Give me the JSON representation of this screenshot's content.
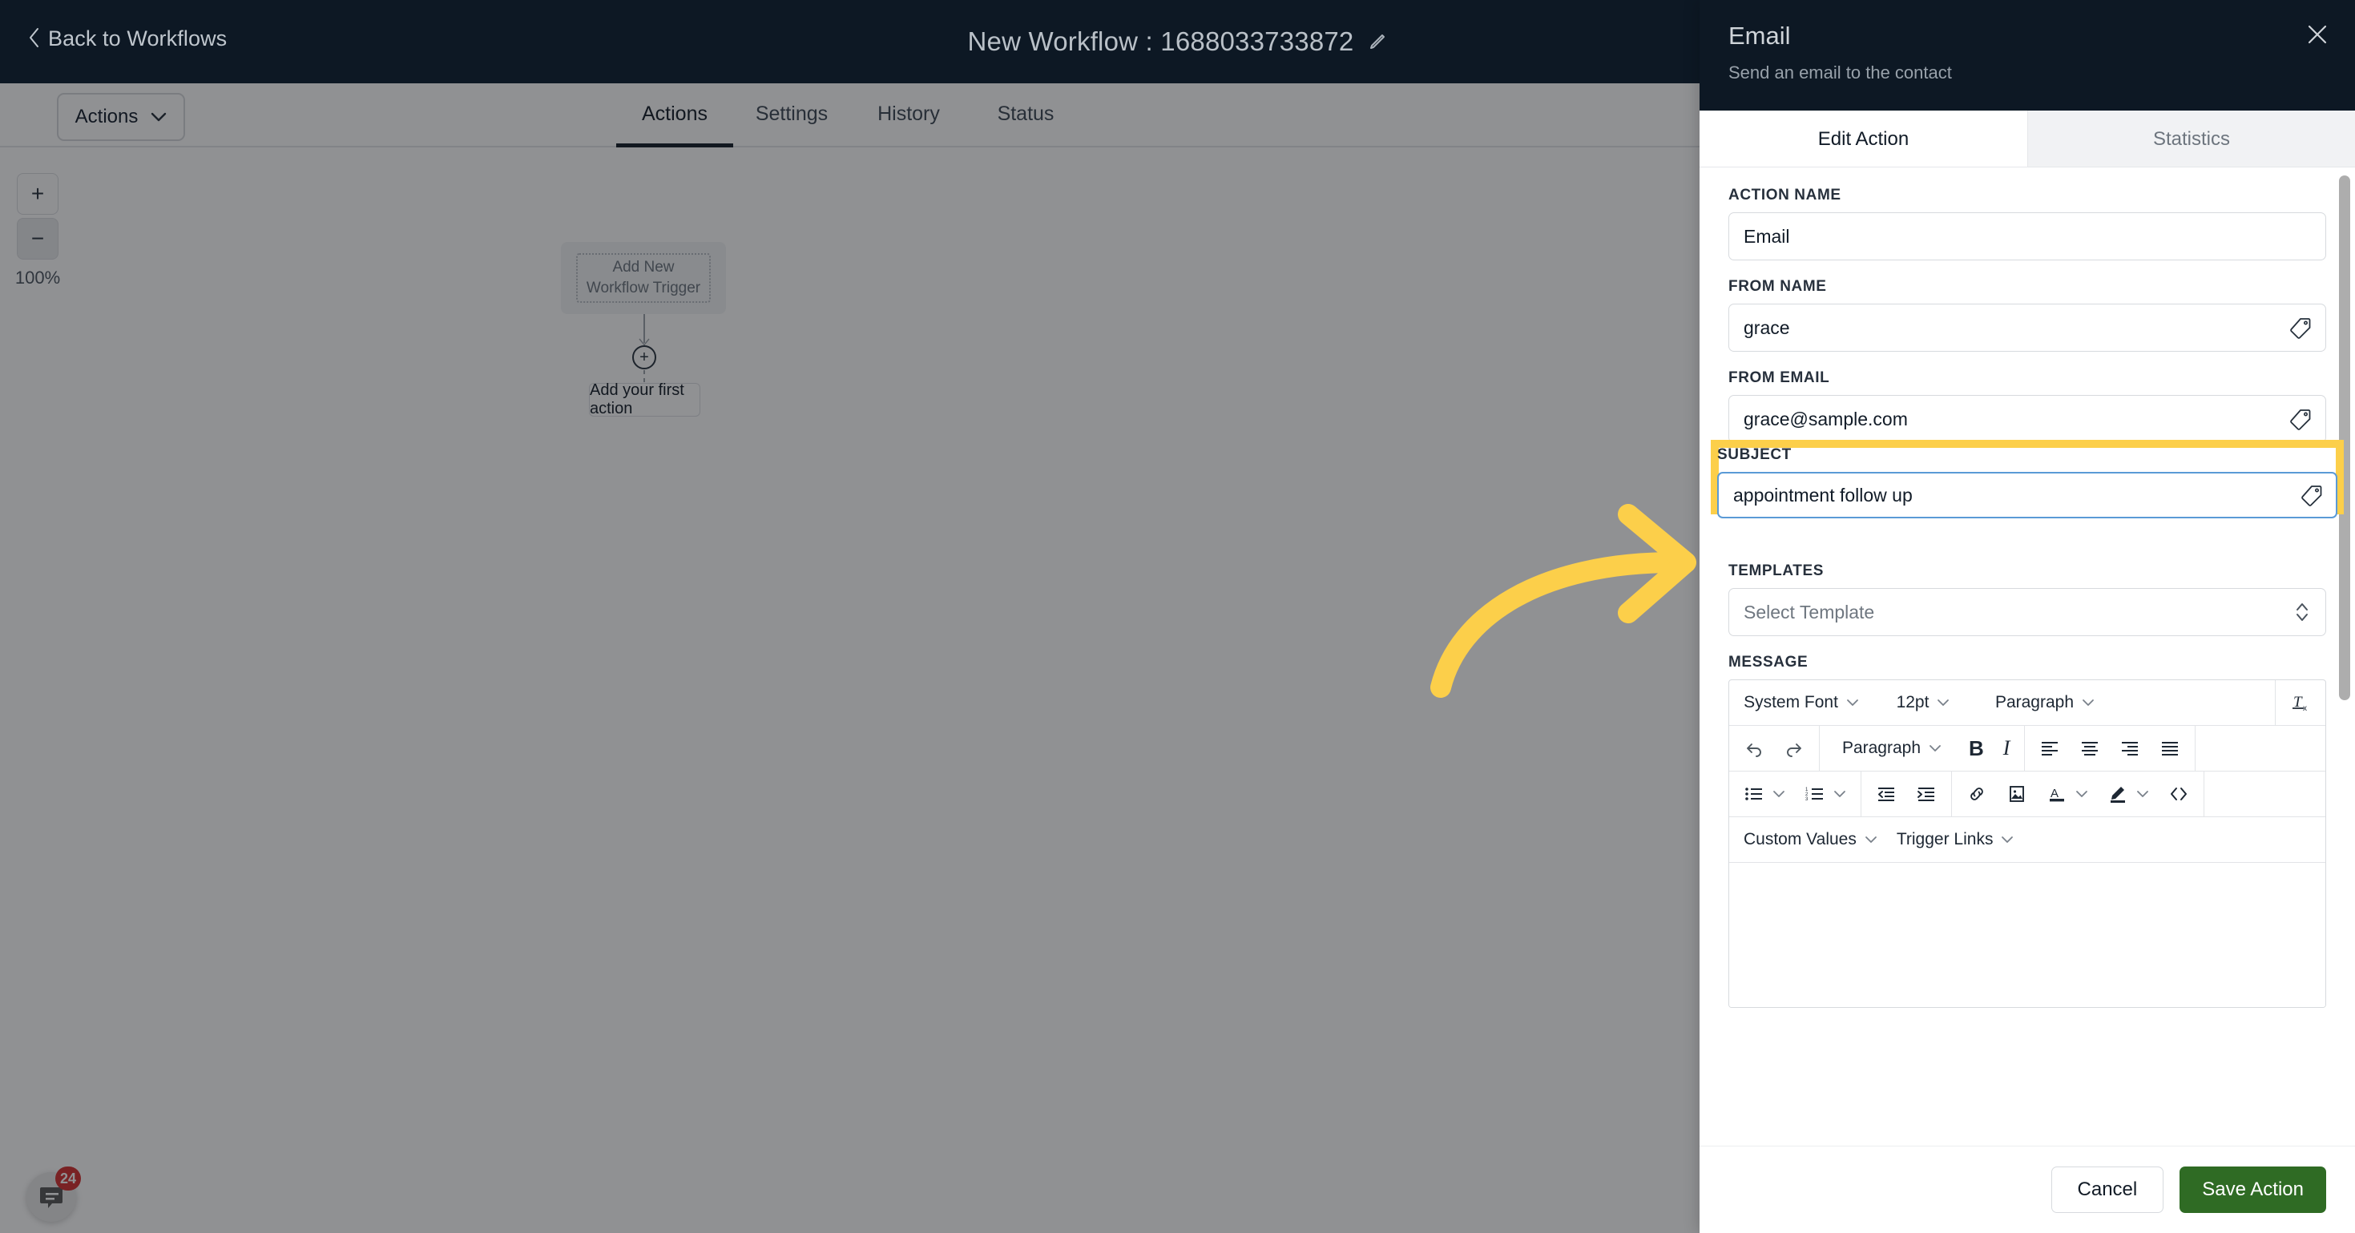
{
  "topbar": {
    "back_label": "Back to Workflows",
    "workflow_title": "New Workflow : 1688033733872",
    "edit_icon": "pencil-icon"
  },
  "tabs": [
    {
      "label": "Actions",
      "active": true
    },
    {
      "label": "Settings",
      "active": false
    },
    {
      "label": "History",
      "active": false
    },
    {
      "label": "Status",
      "active": false
    }
  ],
  "subbar": {
    "actions_button": "Actions",
    "actions_caret": "chevron-down-icon"
  },
  "canvas": {
    "zoom_in": "+",
    "zoom_out": "−",
    "zoom_level": "100%",
    "trigger_node": "Add New Workflow Trigger",
    "add_node_icon": "plus-circle-icon",
    "first_action_node": "Add your first action"
  },
  "chat_widget": {
    "icon": "chat-bubble-icon",
    "badge_count": "24"
  },
  "panel": {
    "title": "Email",
    "subtitle": "Send an email to the contact",
    "close_icon": "close-icon",
    "tabs": [
      {
        "label": "Edit Action",
        "active": true
      },
      {
        "label": "Statistics",
        "active": false
      }
    ],
    "fields": {
      "action_name": {
        "label": "ACTION NAME",
        "value": "Email"
      },
      "from_name": {
        "label": "FROM NAME",
        "value": "grace",
        "icon": "tag-icon"
      },
      "from_email": {
        "label": "FROM EMAIL",
        "value": "grace@sample.com",
        "icon": "tag-icon"
      },
      "subject": {
        "label": "SUBJECT",
        "value": "appointment follow up",
        "icon": "tag-icon",
        "highlighted": true,
        "focused": true
      },
      "templates": {
        "label": "TEMPLATES",
        "value": "Select Template",
        "icon": "chevron-updown-icon"
      },
      "message": {
        "label": "MESSAGE"
      }
    },
    "editor": {
      "row1": {
        "font_family": "System Font",
        "font_size": "12pt",
        "block_format": "Paragraph",
        "clear_format_icon": "clear-formatting-icon"
      },
      "row2": {
        "undo_icon": "undo-icon",
        "redo_icon": "redo-icon",
        "block_format": "Paragraph",
        "bold": "B",
        "italic": "I",
        "align_left_icon": "align-left-icon",
        "align_center_icon": "align-center-icon",
        "align_right_icon": "align-right-icon",
        "align_justify_icon": "align-justify-icon"
      },
      "row3": {
        "bullet_list_icon": "bullet-list-icon",
        "numbered_list_icon": "numbered-list-icon",
        "outdent_icon": "outdent-icon",
        "indent_icon": "indent-icon",
        "link_icon": "link-icon",
        "image_icon": "image-icon",
        "text_color_icon": "text-color-icon",
        "highlight_color_icon": "highlight-color-icon",
        "source_code_icon": "source-code-icon"
      },
      "row4": {
        "custom_values": "Custom Values",
        "trigger_links": "Trigger Links"
      },
      "body_text": ""
    },
    "footer": {
      "cancel": "Cancel",
      "save": "Save Action"
    }
  },
  "annotation": {
    "type": "curved-arrow",
    "color": "#fccf4a",
    "points_to": "subject-field",
    "highlight_color": "#fccf4a"
  },
  "colors": {
    "dark_header": "#0d1824",
    "accent_yellow": "#fccf4a",
    "save_green": "#2f6b24",
    "focus_blue": "#5a9ad6",
    "badge_red": "#d32f2f"
  }
}
